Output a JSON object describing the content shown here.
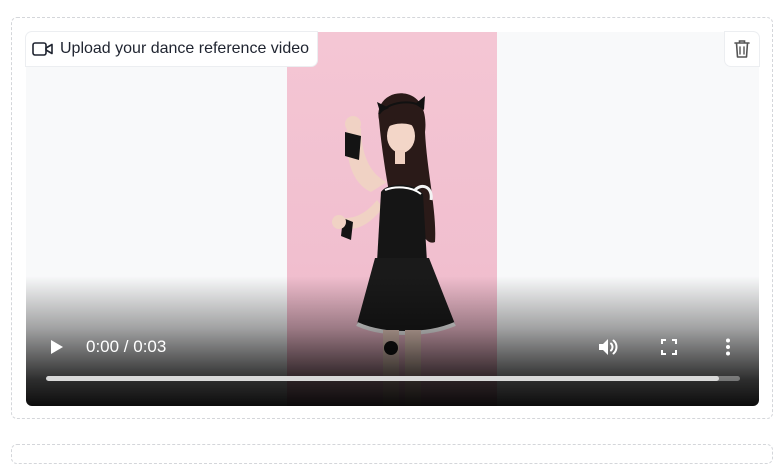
{
  "upload": {
    "label": "Upload your dance reference video",
    "icon": "video-camera-icon"
  },
  "actions": {
    "delete_icon": "trash-icon"
  },
  "player": {
    "time_display": "0:00 / 0:03",
    "current_time": "0:00",
    "duration": "0:03",
    "buffered_fraction": 0.97,
    "play_icon": "play-icon",
    "volume_icon": "volume-icon",
    "fullscreen_icon": "fullscreen-icon",
    "more_icon": "more-options-icon"
  },
  "colors": {
    "frame_background": "#f4c6d4",
    "area_background": "#f8f9fa",
    "text": "#1f2430"
  }
}
